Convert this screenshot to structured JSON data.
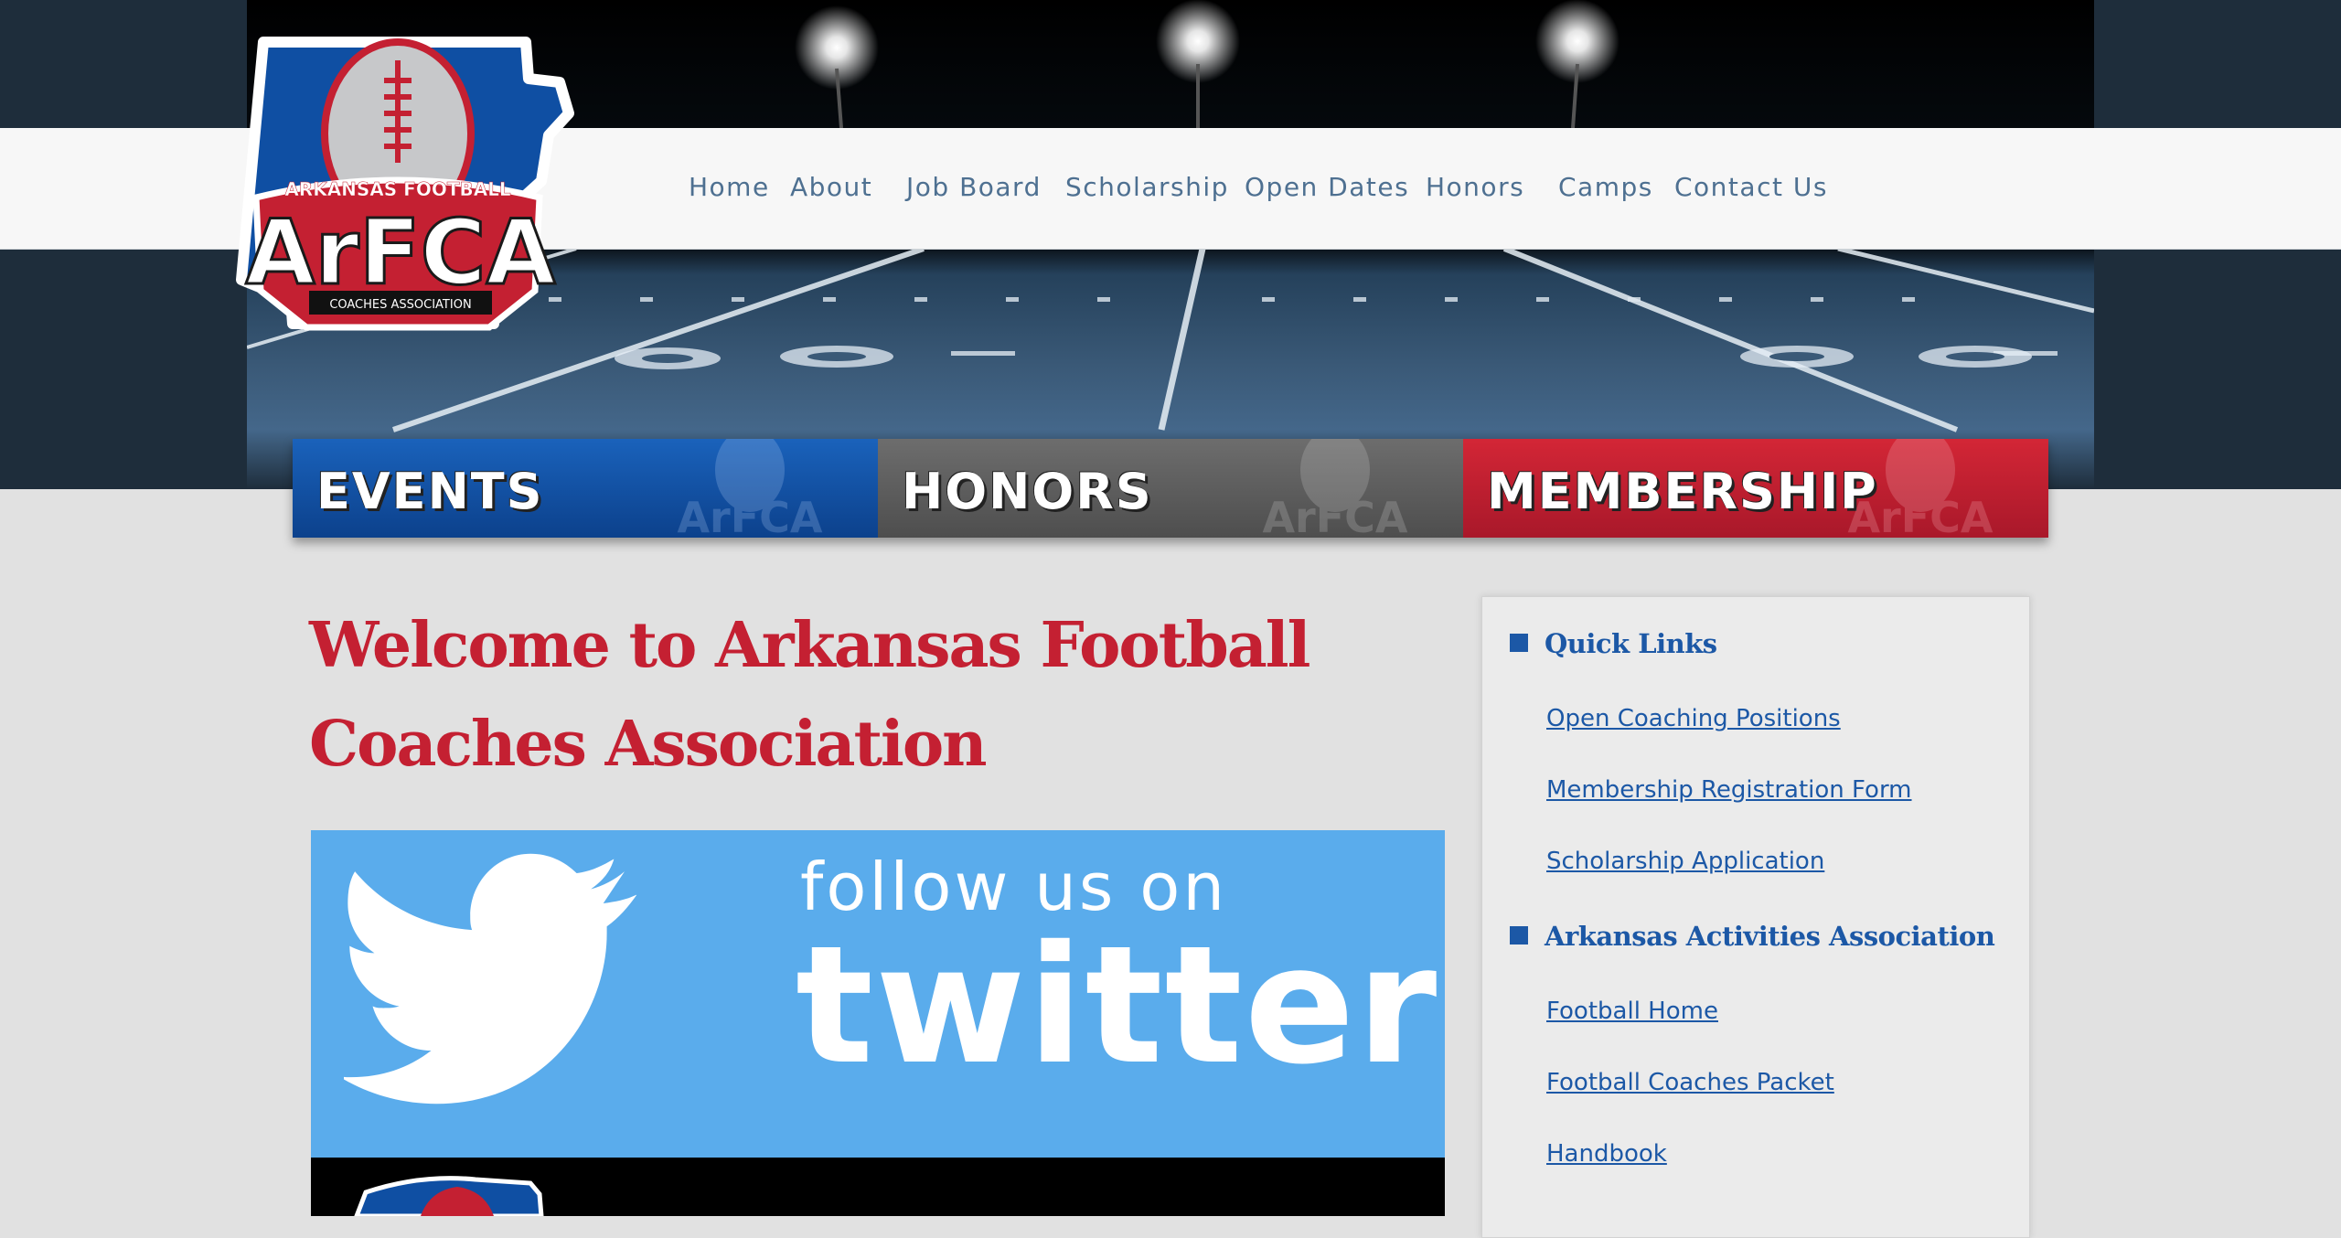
{
  "colors": {
    "accent_red": "#c42032",
    "link_blue": "#1c58a6",
    "nav_text": "#4e7091",
    "events_blue": "#0f4fa3",
    "honors_gray": "#5f5f5f",
    "membership_red": "#c01f2e",
    "twitter_blue": "#5aacec"
  },
  "logo": {
    "top_text": "ARKANSAS FOOTBALL",
    "main_text": "ArFCA",
    "bottom_text": "COACHES ASSOCIATION"
  },
  "nav": {
    "items": [
      {
        "label": "Home"
      },
      {
        "label": "About"
      },
      {
        "label": "Job Board"
      },
      {
        "label": "Scholarship"
      },
      {
        "label": "Open Dates"
      },
      {
        "label": "Honors"
      },
      {
        "label": "Camps"
      },
      {
        "label": "Contact Us"
      }
    ]
  },
  "banner": {
    "tiles": [
      {
        "label": "EVENTS",
        "watermark": "ArFCA"
      },
      {
        "label": "HONORS",
        "watermark": "ArFCA"
      },
      {
        "label": "MEMBERSHIP",
        "watermark": "ArFCA"
      }
    ]
  },
  "main": {
    "title": "Welcome to Arkansas Football Coaches Association",
    "twitter": {
      "line1": "follow us on",
      "line2": "twitter",
      "icon": "twitter-bird-icon"
    }
  },
  "sidebar": {
    "sections": [
      {
        "heading": "Quick Links",
        "links": [
          "Open Coaching Positions",
          "Membership Registration Form",
          "Scholarship Application"
        ]
      },
      {
        "heading": "Arkansas Activities Association",
        "links": [
          "Football Home",
          "Football Coaches Packet",
          "Handbook"
        ]
      }
    ]
  }
}
